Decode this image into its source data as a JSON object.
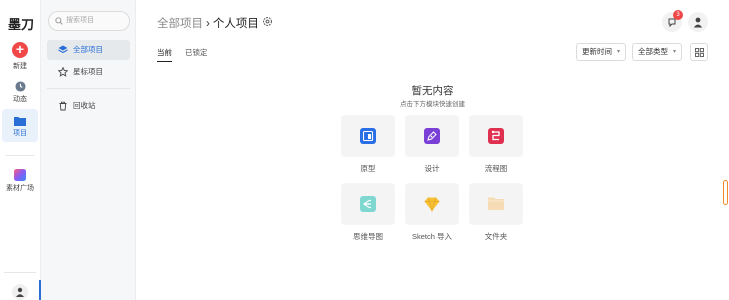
{
  "app": {
    "logo_text": "墨刀"
  },
  "rail": {
    "new_label": "新建",
    "recent_label": "动态",
    "project_label": "项目",
    "market_label": "素材广场"
  },
  "sidebar": {
    "search_placeholder": "搜索项目",
    "items": [
      {
        "label": "全部项目"
      },
      {
        "label": "星标项目"
      },
      {
        "label": "回收站"
      }
    ]
  },
  "header": {
    "crumb_parent": "全部项目",
    "crumb_separator": "›",
    "crumb_current": "个人项目",
    "notification_count": "3"
  },
  "tabs": [
    {
      "label": "当前"
    },
    {
      "label": "已锁定"
    }
  ],
  "filters": {
    "sort_label": "更新时间",
    "type_label": "全部类型"
  },
  "empty": {
    "title": "暂无内容",
    "subtitle": "点击下方模块快速创建"
  },
  "create_tiles": [
    {
      "label": "原型",
      "icon": "prototype-icon",
      "color": "#2b6fe6"
    },
    {
      "label": "设计",
      "icon": "design-pen-icon",
      "color": "#7a3fd6"
    },
    {
      "label": "流程图",
      "icon": "flowchart-icon",
      "color": "#e03050"
    },
    {
      "label": "思维导图",
      "icon": "mindmap-icon",
      "color": "#7fd8d0"
    },
    {
      "label": "Sketch 导入",
      "icon": "sketch-icon",
      "color": "#f5c23a"
    },
    {
      "label": "文件夹",
      "icon": "folder-icon",
      "color": "#f6dcb4"
    }
  ],
  "colors": {
    "accent": "#2a6fd6",
    "danger": "#f04848"
  }
}
